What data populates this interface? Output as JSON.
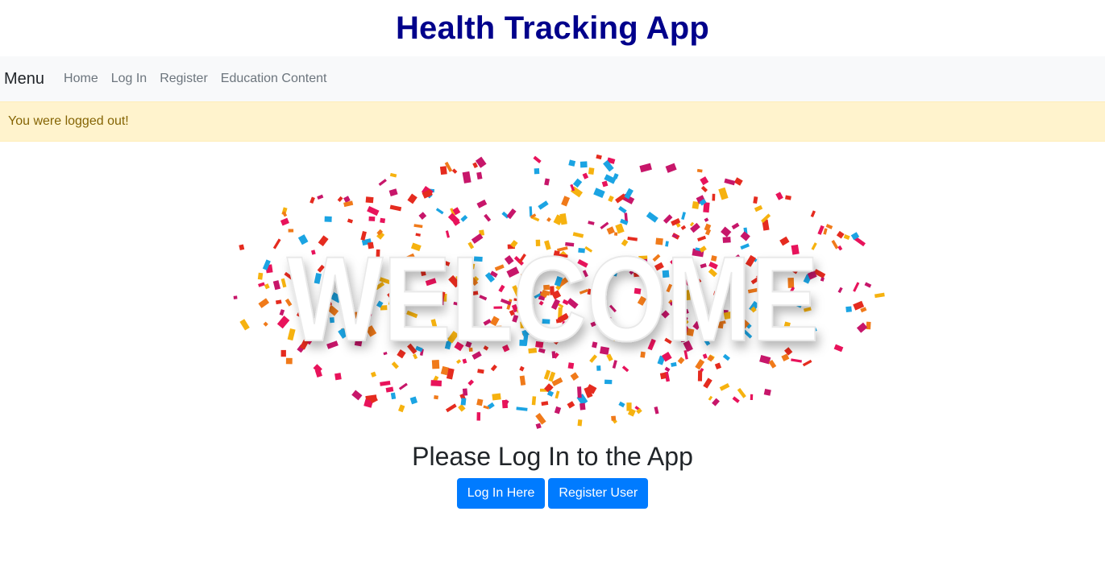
{
  "header": {
    "title": "Health Tracking App"
  },
  "navbar": {
    "brand": "Menu",
    "links": [
      "Home",
      "Log In",
      "Register",
      "Education Content"
    ]
  },
  "alert": {
    "message": "You were logged out!"
  },
  "hero": {
    "welcome_text": "WELCOME",
    "confetti_colors": [
      "#e8135b",
      "#f6b20f",
      "#1ba4e3",
      "#e52b1f",
      "#f07a1a",
      "#c7166a"
    ]
  },
  "prompt": {
    "heading": "Please Log In to the App"
  },
  "actions": {
    "login_label": "Log In Here",
    "register_label": "Register User"
  }
}
